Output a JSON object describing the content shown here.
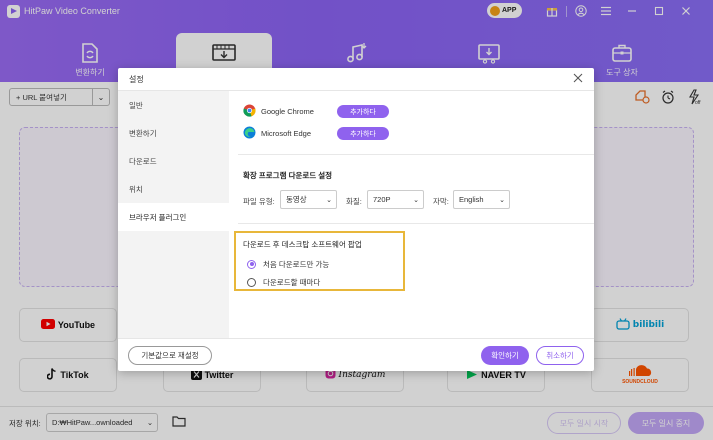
{
  "app": {
    "title": "HitPaw Video Converter",
    "badge": "APP"
  },
  "main_tabs": [
    {
      "label": "변환하기",
      "icon": "convert-icon"
    },
    {
      "label": "",
      "icon": "download-icon",
      "active": true
    },
    {
      "label": "",
      "icon": "music-icon"
    },
    {
      "label": "",
      "icon": "video-edit-icon"
    },
    {
      "label": "도구 상자",
      "icon": "toolbox-icon"
    }
  ],
  "toolbar": {
    "url_paste": "+ URL 붙여넣기"
  },
  "sites": [
    {
      "name": "YouTube"
    },
    {
      "name": "bilibili"
    },
    {
      "name": "TikTok"
    },
    {
      "name": "Twitter"
    },
    {
      "name": "Instagram"
    },
    {
      "name": "NAVER TV"
    },
    {
      "name": "SOUNDCLOUD"
    }
  ],
  "bottom": {
    "save_label": "저장 위치:",
    "save_path": "D:₩HitPaw...ownloaded",
    "pause_all": "모두 일시 시작",
    "stop_all": "모두 일시 중지"
  },
  "dialog": {
    "title": "설정",
    "sidebar": [
      "일반",
      "변환하기",
      "다운로드",
      "위치",
      "브라우저 플러그인"
    ],
    "active_index": 4,
    "browsers": [
      {
        "name": "Google Chrome",
        "action": "추가하다"
      },
      {
        "name": "Microsoft Edge",
        "action": "추가하다"
      }
    ],
    "ext_section_title": "확장 프로그램 다운로드 설정",
    "file_type_label": "파일 유형:",
    "file_type_value": "동영상",
    "quality_label": "화질:",
    "quality_value": "720P",
    "subtitle_label": "자막:",
    "subtitle_value": "English",
    "popup_title": "다운로드 후 데스크탑 소프트웨어 팝업",
    "popup_options": [
      {
        "label": "처음 다운로드만 가능",
        "selected": true
      },
      {
        "label": "다운로드할 때마다",
        "selected": false
      }
    ],
    "reset_label": "기본값으로 재설정",
    "ok_label": "확인하기",
    "cancel_label": "취소하기"
  },
  "colors": {
    "accent": "#8f62ee",
    "highlight": "#e8b73a",
    "youtube": "#ff0000",
    "bilibili": "#00a1d6"
  }
}
